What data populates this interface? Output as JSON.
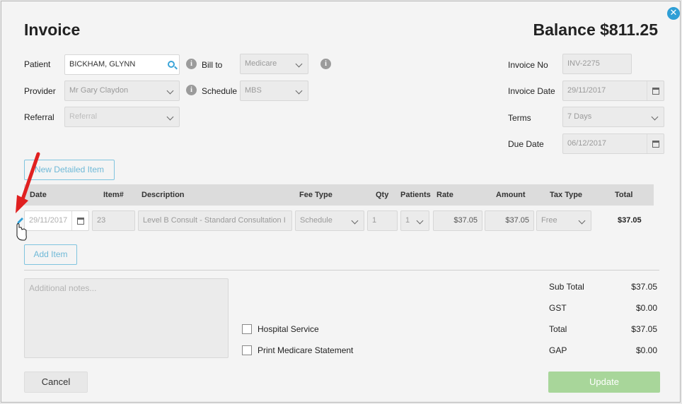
{
  "dialog": {
    "title": "Invoice",
    "balance": "Balance $811.25"
  },
  "form": {
    "patient_label": "Patient",
    "patient_value": "BICKHAM, GLYNN",
    "bill_to_label": "Bill to",
    "bill_to_value": "Medicare",
    "provider_label": "Provider",
    "provider_value": "Mr Gary Claydon",
    "schedule_label": "Schedule",
    "schedule_value": "MBS",
    "referral_label": "Referral",
    "referral_placeholder": "Referral",
    "invoice_no_label": "Invoice No",
    "invoice_no_value": "INV-2275",
    "invoice_date_label": "Invoice Date",
    "invoice_date_value": "29/11/2017",
    "terms_label": "Terms",
    "terms_value": "7 Days",
    "due_date_label": "Due Date",
    "due_date_value": "06/12/2017"
  },
  "buttons": {
    "new_detailed_item": "New Detailed Item",
    "add_item": "Add Item",
    "cancel": "Cancel",
    "update": "Update"
  },
  "table": {
    "headers": [
      "Date",
      "Item#",
      "Description",
      "Fee Type",
      "Qty",
      "Patients",
      "Rate",
      "Amount",
      "Tax Type",
      "Total"
    ],
    "row": {
      "date": "29/11/2017",
      "item": "23",
      "description": "Level B Consult - Standard Consultation I",
      "fee_type": "Schedule",
      "qty": "1",
      "patients": "1",
      "rate": "$37.05",
      "amount": "$37.05",
      "tax_type": "Free",
      "total": "$37.05"
    }
  },
  "notes": {
    "placeholder": "Additional notes..."
  },
  "options": {
    "hospital_service": "Hospital Service",
    "print_medicare": "Print Medicare Statement"
  },
  "totals": {
    "sub_total_label": "Sub Total",
    "sub_total": "$37.05",
    "gst_label": "GST",
    "gst": "$0.00",
    "total_label": "Total",
    "total": "$37.05",
    "gap_label": "GAP",
    "gap": "$0.00"
  },
  "colors": {
    "accent": "#2f9fd6",
    "update_button": "#a8d69a",
    "annotation_arrow": "#e02020"
  }
}
